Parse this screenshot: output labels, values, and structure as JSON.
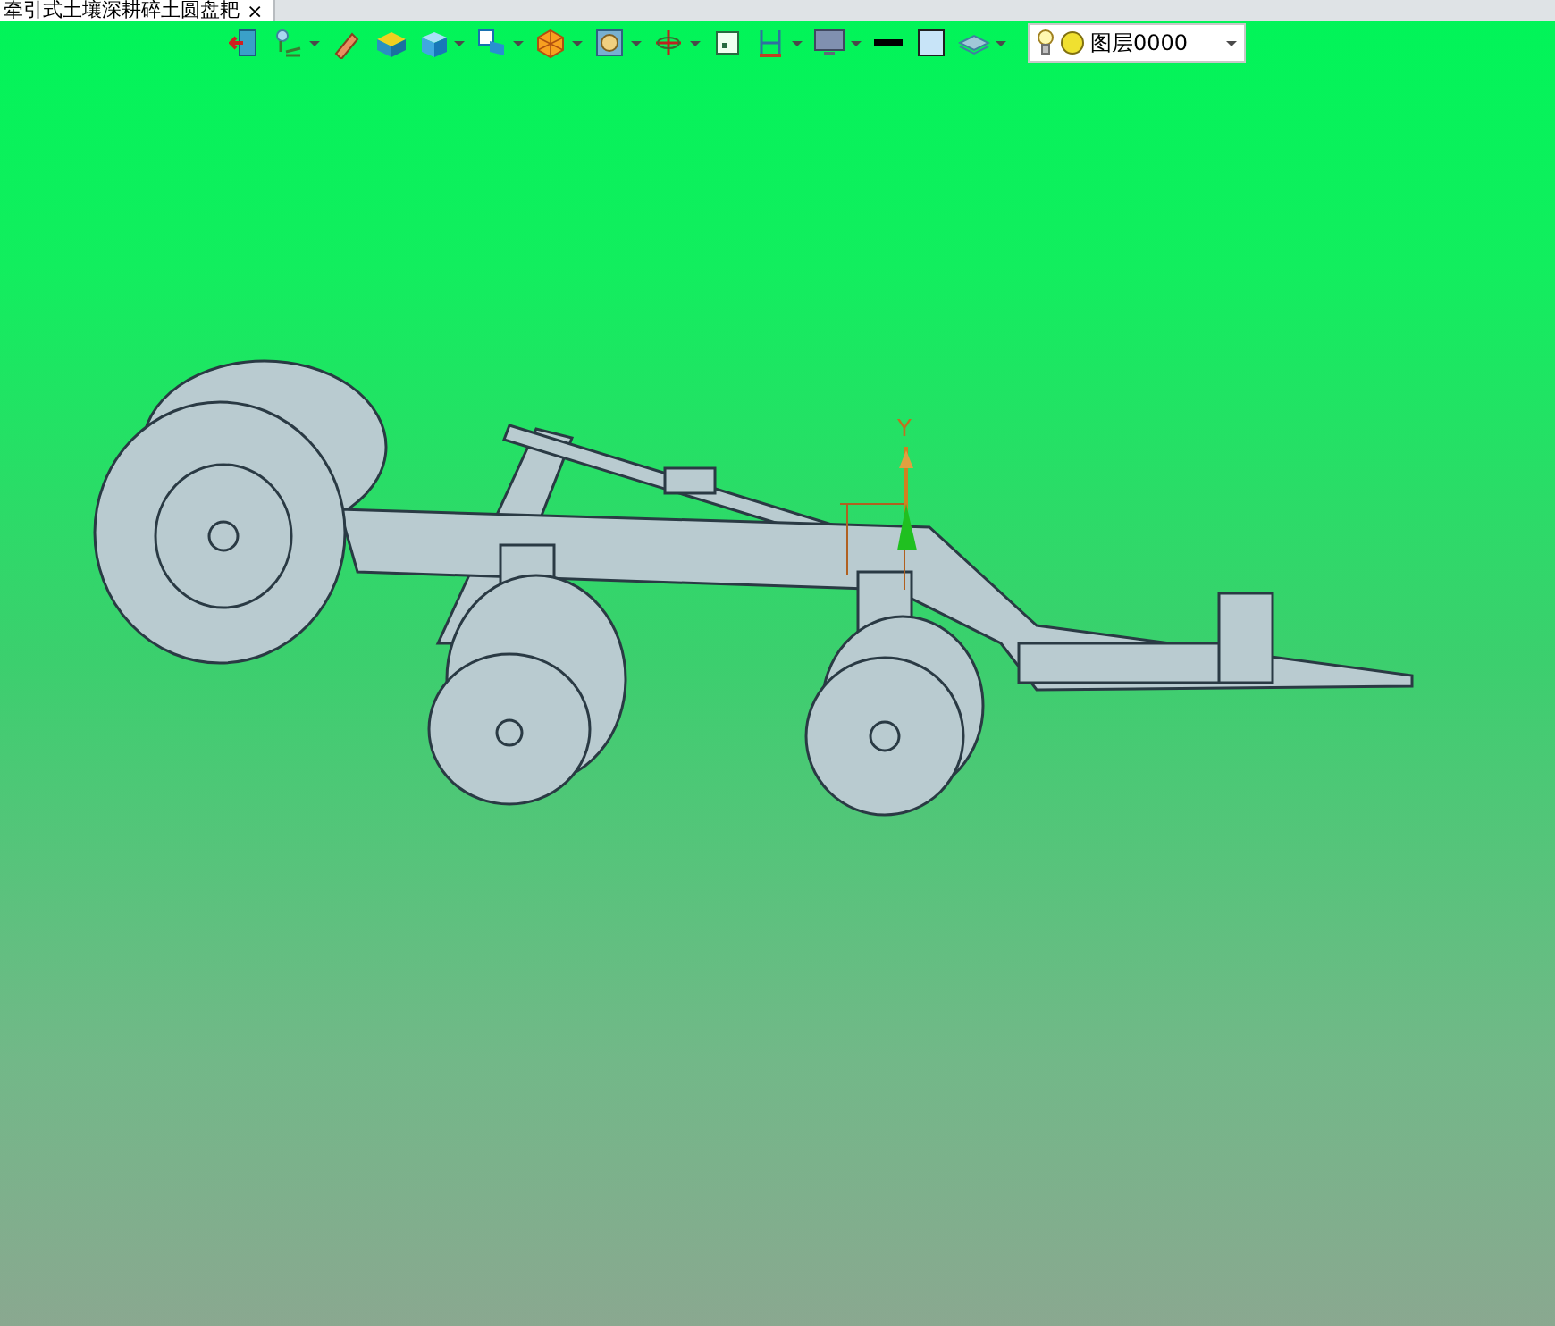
{
  "document_tab": {
    "title": "牵引式土壤深耕碎土圆盘耙",
    "close": "×"
  },
  "toolbar": {
    "tools": [
      {
        "kind": "exit",
        "has_menu": false
      },
      {
        "kind": "light",
        "has_menu": true
      },
      {
        "kind": "pencil",
        "has_menu": false
      },
      {
        "kind": "box",
        "has_menu": false
      },
      {
        "kind": "cube",
        "has_menu": true
      },
      {
        "kind": "view",
        "has_menu": true
      },
      {
        "kind": "polygon",
        "has_menu": true
      },
      {
        "kind": "zoom",
        "has_menu": true
      },
      {
        "kind": "orbit",
        "has_menu": true
      },
      {
        "kind": "panel",
        "has_menu": false
      },
      {
        "kind": "layout",
        "has_menu": true
      },
      {
        "kind": "monitor",
        "has_menu": true
      },
      {
        "kind": "line",
        "has_menu": false
      },
      {
        "kind": "fill",
        "has_menu": false
      },
      {
        "kind": "layers",
        "has_menu": true
      }
    ],
    "layer_select": {
      "value": "图层0000"
    }
  },
  "viewport": {
    "axis_label": "Y"
  }
}
